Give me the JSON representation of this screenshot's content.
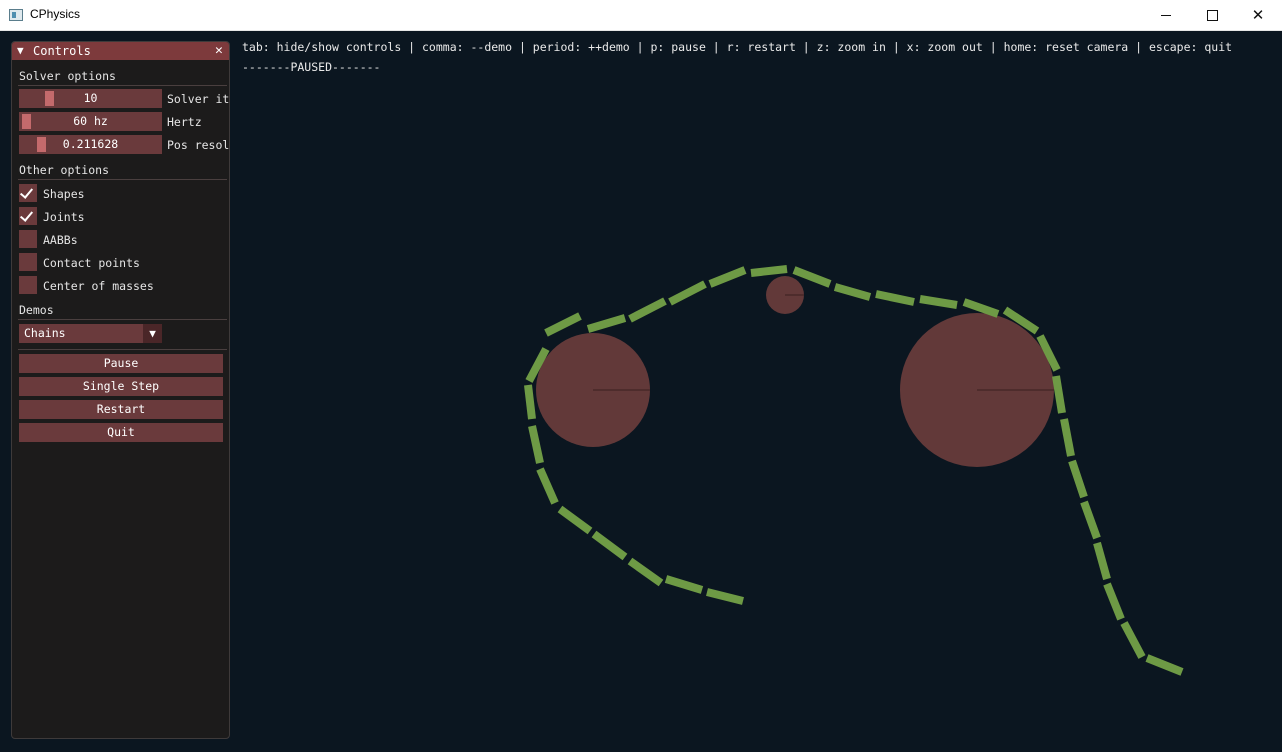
{
  "window": {
    "title": "CPhysics"
  },
  "hints": {
    "keys": "tab: hide/show controls | comma: --demo | period: ++demo | p: pause | r: restart | z: zoom in | x: zoom out | home: reset camera | escape: quit",
    "status": "-------PAUSED-------"
  },
  "controls": {
    "title": "Controls",
    "solver_section": "Solver options",
    "sliders": [
      {
        "value": "10",
        "label": "Solver it",
        "level": 0.2
      },
      {
        "value": "60 hz",
        "label": "Hertz",
        "level": 0.02
      },
      {
        "value": "0.211628",
        "label": "Pos resol",
        "level": 0.16
      }
    ],
    "other_section": "Other options",
    "checkboxes": [
      {
        "label": "Shapes",
        "checked": true
      },
      {
        "label": "Joints",
        "checked": true
      },
      {
        "label": "AABBs",
        "checked": false
      },
      {
        "label": "Contact points",
        "checked": false
      },
      {
        "label": "Center of masses",
        "checked": false
      }
    ],
    "demos_section": "Demos",
    "demo_selected": "Chains",
    "buttons": {
      "pause": "Pause",
      "single_step": "Single Step",
      "restart": "Restart",
      "quit": "Quit"
    }
  },
  "colors": {
    "background": "#0b1620",
    "panel_header": "#7d3a3c",
    "widget": "#6a3a3c",
    "chain_link": "#6e9a45",
    "circle_body": "#623939"
  }
}
